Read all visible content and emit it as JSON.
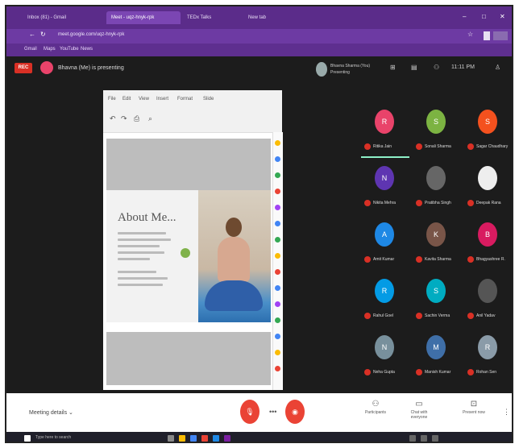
{
  "browser": {
    "tabs": [
      "Inbox (81) - Gmail",
      "Meet - uqz-hnyk-rpk",
      "TEDx Talks",
      "New tab"
    ],
    "address": "meet.google.com/uqz-hnyk-rpk",
    "bookmarks": [
      "Gmail",
      "Maps",
      "YouTube",
      "News"
    ]
  },
  "meeting": {
    "rec_label": "REC",
    "presenting_text": "Bhavna (Me) is presenting",
    "self_name": "Bhavna Sharma (You)",
    "self_sub": "Presenting",
    "clock": "11:11 PM"
  },
  "shared": {
    "tools": [
      "File",
      "Edit",
      "View",
      "Insert",
      "Format",
      "Slide"
    ],
    "heading": "About Me..."
  },
  "participants": [
    {
      "name": "Ritika Jain",
      "letter": "R",
      "color": "#e9436a"
    },
    {
      "name": "Sonali Sharma",
      "letter": "S",
      "color": "#7cb342"
    },
    {
      "name": "Sagar Chaudhary",
      "letter": "S",
      "color": "#f4511e"
    },
    {
      "name": "Nikita Mehra",
      "letter": "N",
      "color": "#5e35b1"
    },
    {
      "name": "Pratibha Singh",
      "letter": "",
      "color": "#666666"
    },
    {
      "name": "Deepak Rana",
      "letter": "",
      "color": "#eeeeee"
    },
    {
      "name": "Amit Kumar",
      "letter": "A",
      "color": "#1e88e5"
    },
    {
      "name": "Kavita Sharma",
      "letter": "K",
      "color": "#795548"
    },
    {
      "name": "Bhagyashree R.",
      "letter": "B",
      "color": "#d81b60"
    },
    {
      "name": "Rahul Goel",
      "letter": "R",
      "color": "#039be5"
    },
    {
      "name": "Sachin Verma",
      "letter": "S",
      "color": "#00acc1"
    },
    {
      "name": "Anil Yadav",
      "letter": "",
      "color": "#555555"
    },
    {
      "name": "Neha Gupta",
      "letter": "N",
      "color": "#78909c"
    },
    {
      "name": "Manish Kumar",
      "letter": "M",
      "color": "#3f6fa8"
    },
    {
      "name": "Rohan Sen",
      "letter": "R",
      "color": "#8a9ba8"
    }
  ],
  "bottom": {
    "meeting_details": "Meeting details",
    "mic_off": "Mic off",
    "cam_off": "Camera off",
    "participants_label": "Participants",
    "chat_label": "Chat with everyone",
    "present_label": "Present now"
  },
  "taskbar": {
    "search": "Type here to search"
  }
}
